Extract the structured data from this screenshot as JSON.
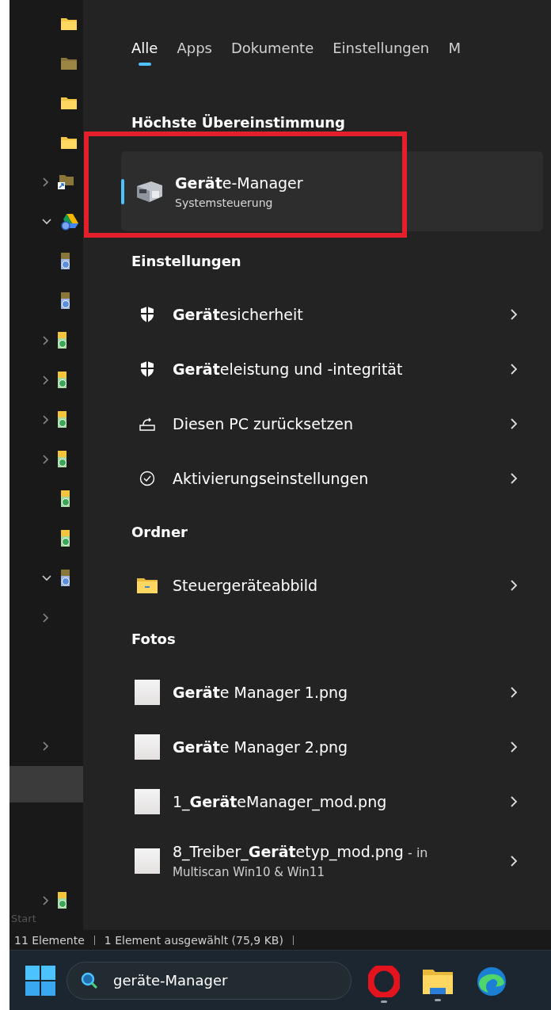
{
  "explorer": {
    "tree": [
      {
        "kind": "folder",
        "selected": false
      },
      {
        "kind": "folder_dim",
        "selected": false
      },
      {
        "kind": "folder",
        "selected": false
      },
      {
        "kind": "folder",
        "selected": false
      },
      {
        "kind": "shortcut",
        "expanded": false,
        "selected": false
      },
      {
        "kind": "drive",
        "expanded": true,
        "selected": false
      },
      {
        "kind": "fileblue",
        "selected": false
      },
      {
        "kind": "fileblue",
        "selected": false
      },
      {
        "kind": "filegreen",
        "expanded": false,
        "selected": false
      },
      {
        "kind": "filegreen",
        "expanded": false,
        "selected": false
      },
      {
        "kind": "filegreen",
        "expanded": false,
        "selected": false
      },
      {
        "kind": "filegreen",
        "expanded": false,
        "selected": false
      },
      {
        "kind": "filegreen",
        "selected": false
      },
      {
        "kind": "filegreen",
        "selected": false
      },
      {
        "kind": "fileblue",
        "expanded": true,
        "selected": false
      },
      {
        "expanded": false,
        "selected": false
      }
    ],
    "tree_lower": [
      {
        "expanded": false,
        "selected": false
      },
      {
        "selected": true
      }
    ],
    "tree_last": {
      "kind": "filegreen",
      "expanded": false,
      "selected": false
    },
    "start_label": "Start"
  },
  "search": {
    "tabs": [
      {
        "label": "Alle",
        "selected": true
      },
      {
        "label": "Apps",
        "selected": false
      },
      {
        "label": "Dokumente",
        "selected": false
      },
      {
        "label": "Einstellungen",
        "selected": false
      },
      {
        "label": "M",
        "selected": false
      }
    ],
    "best_match": {
      "heading": "Höchste Übereinstimmung",
      "title": "**Gerät**e-Manager",
      "subtitle": "Systemsteuerung",
      "selected": true
    },
    "sections": [
      {
        "title": "Einstellungen",
        "items": [
          {
            "kind": "shield",
            "label": "**Gerät**esicherheit"
          },
          {
            "kind": "shield",
            "label": "**Gerät**eleistung und -integrität"
          },
          {
            "kind": "reset",
            "label": "Diesen PC zurücksetzen"
          },
          {
            "kind": "check",
            "label": "Aktivierungseinstellungen"
          }
        ]
      },
      {
        "title": "Ordner",
        "items": [
          {
            "kind": "folder",
            "label": "Steuergeräteabbild"
          }
        ]
      },
      {
        "title": "Fotos",
        "items": [
          {
            "kind": "image",
            "label": "**Gerät**e Manager 1.png"
          },
          {
            "kind": "image",
            "label": "**Gerät**e Manager 2.png"
          },
          {
            "kind": "image",
            "label": "1_**Gerät**eManager_mod.png"
          },
          {
            "kind": "image",
            "label": "8_Treiber_**Gerät**etyp_mod.png",
            "suffix": " - in",
            "location": "Multiscan Win10 & Win11"
          }
        ]
      }
    ]
  },
  "status_bar": {
    "items": [
      "11 Elemente",
      "1 Element ausgewählt (75,9 KB)"
    ]
  },
  "taskbar": {
    "search_value": "geräte-Manager",
    "apps": [
      {
        "kind": "opera",
        "running": true
      },
      {
        "kind": "folder",
        "running": true
      },
      {
        "kind": "edge",
        "running": false
      }
    ]
  }
}
